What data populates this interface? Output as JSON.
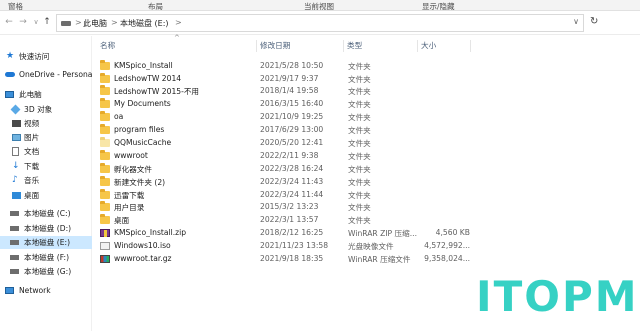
{
  "ribbon": {
    "groups": [
      "窗格",
      "布局",
      "当前视图",
      "显示/隐藏"
    ]
  },
  "address": {
    "back_icon": "arrow-left-icon",
    "forward_icon": "arrow-right-icon",
    "recent_icon": "chevron-down-icon",
    "up_icon": "arrow-up-icon",
    "crumbs": [
      "此电脑",
      "本地磁盘 (E:)"
    ],
    "separator": ">",
    "dropdown": "∨",
    "refresh": "↻"
  },
  "sidebar": {
    "items": [
      {
        "label": "快速访问",
        "icon": "star-icon",
        "selected": false
      },
      {
        "label": "OneDrive - Persona",
        "icon": "cloud-icon",
        "selected": false
      },
      {
        "label": "此电脑",
        "icon": "computer-icon",
        "selected": false
      },
      {
        "label": "3D 对象",
        "icon": "cube-icon",
        "selected": false
      },
      {
        "label": "视频",
        "icon": "video-icon",
        "selected": false
      },
      {
        "label": "图片",
        "icon": "picture-icon",
        "selected": false
      },
      {
        "label": "文档",
        "icon": "document-icon",
        "selected": false
      },
      {
        "label": "下载",
        "icon": "download-icon",
        "selected": false
      },
      {
        "label": "音乐",
        "icon": "music-icon",
        "selected": false
      },
      {
        "label": "桌面",
        "icon": "desktop-icon",
        "selected": false
      },
      {
        "label": "本地磁盘 (C:)",
        "icon": "drive-icon",
        "selected": false
      },
      {
        "label": "本地磁盘 (D:)",
        "icon": "drive-icon",
        "selected": false
      },
      {
        "label": "本地磁盘 (E:)",
        "icon": "drive-icon",
        "selected": true
      },
      {
        "label": "本地磁盘 (F:)",
        "icon": "drive-icon",
        "selected": false
      },
      {
        "label": "本地磁盘 (G:)",
        "icon": "drive-icon",
        "selected": false
      },
      {
        "label": "Network",
        "icon": "network-icon",
        "selected": false
      }
    ]
  },
  "columns": {
    "name": "名称",
    "date": "修改日期",
    "type": "类型",
    "size": "大小",
    "sort_indicator": "^"
  },
  "files": [
    {
      "name": "KMSpico_Install",
      "date": "2021/5/28 10:50",
      "type": "文件夹",
      "size": "",
      "icon": "folder-icon"
    },
    {
      "name": "LedshowTW 2014",
      "date": "2021/9/17 9:37",
      "type": "文件夹",
      "size": "",
      "icon": "folder-icon"
    },
    {
      "name": "LedshowTW 2015-不用",
      "date": "2018/1/4 19:58",
      "type": "文件夹",
      "size": "",
      "icon": "folder-icon"
    },
    {
      "name": "My Documents",
      "date": "2016/3/15 16:40",
      "type": "文件夹",
      "size": "",
      "icon": "folder-icon"
    },
    {
      "name": "oa",
      "date": "2021/10/9 19:25",
      "type": "文件夹",
      "size": "",
      "icon": "folder-icon"
    },
    {
      "name": "program files",
      "date": "2017/6/29 13:00",
      "type": "文件夹",
      "size": "",
      "icon": "folder-icon"
    },
    {
      "name": "QQMusicCache",
      "date": "2020/5/20 12:41",
      "type": "文件夹",
      "size": "",
      "icon": "folder-pale-icon"
    },
    {
      "name": "wwwroot",
      "date": "2022/2/11 9:38",
      "type": "文件夹",
      "size": "",
      "icon": "folder-icon"
    },
    {
      "name": "孵化器文件",
      "date": "2022/3/28 16:24",
      "type": "文件夹",
      "size": "",
      "icon": "folder-icon"
    },
    {
      "name": "新建文件夹 (2)",
      "date": "2022/3/24 11:43",
      "type": "文件夹",
      "size": "",
      "icon": "folder-icon"
    },
    {
      "name": "迅雷下载",
      "date": "2022/3/24 11:44",
      "type": "文件夹",
      "size": "",
      "icon": "folder-icon"
    },
    {
      "name": "用户目录",
      "date": "2015/3/2 13:23",
      "type": "文件夹",
      "size": "",
      "icon": "folder-icon"
    },
    {
      "name": "桌面",
      "date": "2022/3/1 13:57",
      "type": "文件夹",
      "size": "",
      "icon": "folder-icon"
    },
    {
      "name": "KMSpico_Install.zip",
      "date": "2018/2/12 16:25",
      "type": "WinRAR ZIP 压缩...",
      "size": "4,560 KB",
      "icon": "zip-archive-icon"
    },
    {
      "name": "Windows10.iso",
      "date": "2021/11/23 13:58",
      "type": "光盘映像文件",
      "size": "4,572,992...",
      "icon": "disc-image-icon"
    },
    {
      "name": "wwwroot.tar.gz",
      "date": "2021/9/18 18:35",
      "type": "WinRAR 压缩文件",
      "size": "9,358,024...",
      "icon": "tar-archive-icon"
    }
  ],
  "watermark": "ITOPM"
}
